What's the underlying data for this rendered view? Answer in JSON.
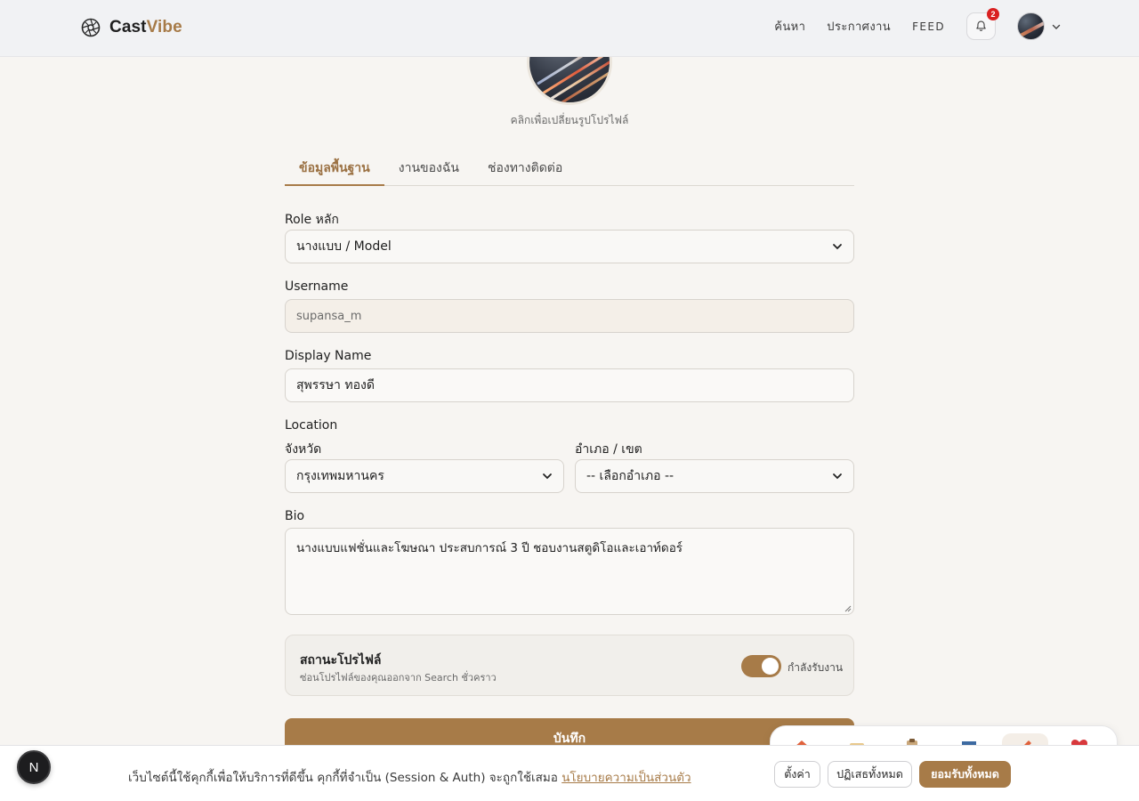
{
  "brand": {
    "name_part1": "Cast",
    "name_part2": "Vibe"
  },
  "nav": {
    "search": "ค้นหา",
    "announcements": "ประกาศงาน",
    "feed": "FEED",
    "notification_count": "2"
  },
  "profile": {
    "change_photo_caption": "คลิกเพื่อเปลี่ยนรูปโปรไฟล์"
  },
  "tabs": [
    {
      "label": "ข้อมูลพื้นฐาน",
      "active": true
    },
    {
      "label": "งานของฉัน",
      "active": false
    },
    {
      "label": "ช่องทางติดต่อ",
      "active": false
    }
  ],
  "form": {
    "role": {
      "label": "Role หลัก",
      "value": "นางแบบ / Model"
    },
    "username": {
      "label": "Username",
      "value": "supansa_m"
    },
    "display_name": {
      "label": "Display Name",
      "value": "สุพรรษา ทองดี"
    },
    "location": {
      "label": "Location",
      "province_label": "จังหวัด",
      "province_value": "กรุงเทพมหานคร",
      "district_label": "อำเภอ / เขต",
      "district_value": "-- เลือกอำเภอ --"
    },
    "bio": {
      "label": "Bio",
      "value": "นางแบบแฟชั่นและโฆษณา ประสบการณ์ 3 ปี ชอบงานสตูดิโอและเอาท์ดอร์"
    },
    "status": {
      "title": "สถานะโปรไฟล์",
      "subtitle": "ซ่อนโปรไฟล์ของคุณออกจาก Search ชั่วคราว",
      "toggle_label": "กำลังรับงาน",
      "toggle_on": true
    },
    "save_label": "บันทึก"
  },
  "cookie_banner": {
    "text": "เว็บไซต์นี้ใช้คุกกี้เพื่อให้บริการที่ดีขึ้น คุกกี้ที่จำเป็น (Session & Auth) จะถูกใช้เสมอ",
    "link": "นโยบายความเป็นส่วนตัว",
    "settings": "ตั้งค่า",
    "reject_all": "ปฏิเสธทั้งหมด",
    "accept_all": "ยอมรับทั้งหมด"
  },
  "dev_badge": {
    "letter": "N"
  },
  "colors": {
    "accent": "#a77b48",
    "badge": "#d92020"
  }
}
